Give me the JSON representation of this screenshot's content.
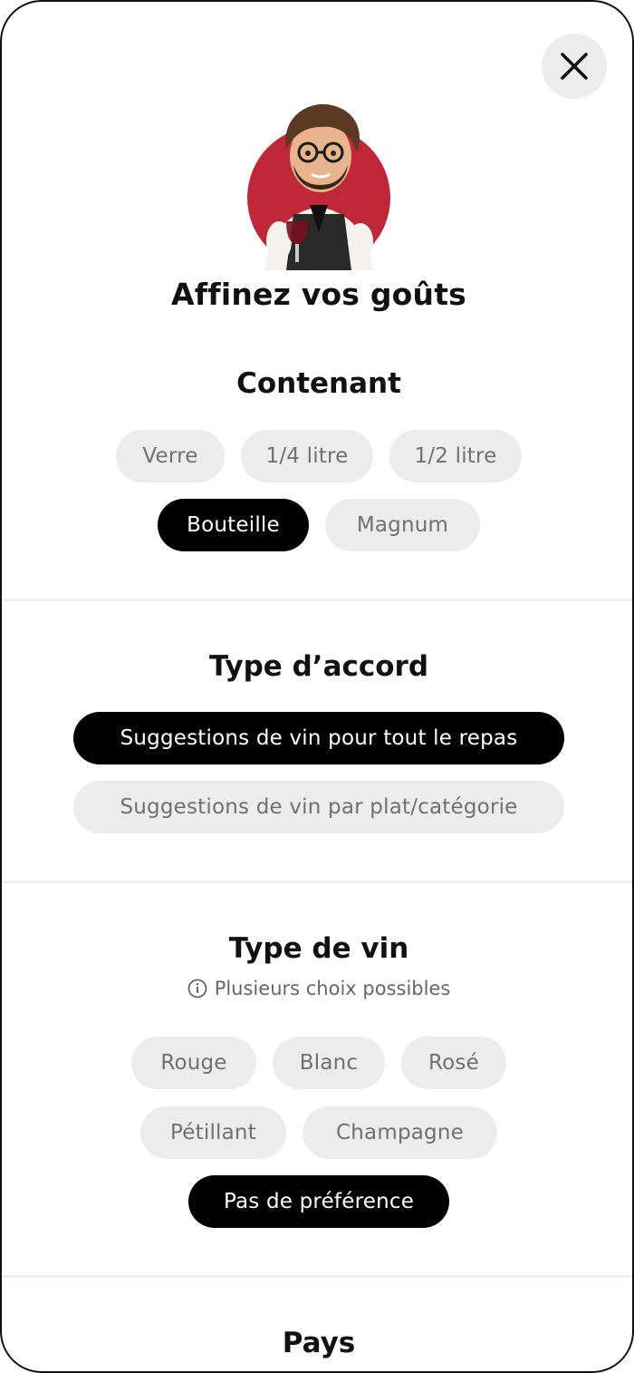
{
  "header": {
    "title": "Affinez vos goûts"
  },
  "sections": {
    "contenant": {
      "title": "Contenant",
      "options": [
        "Verre",
        "1/4 litre",
        "1/2 litre",
        "Bouteille",
        "Magnum"
      ],
      "selected": "Bouteille"
    },
    "accord": {
      "title": "Type d’accord",
      "options": [
        "Suggestions de vin pour tout le repas",
        "Suggestions de vin par plat/catégorie"
      ],
      "selected": "Suggestions de vin pour tout le repas"
    },
    "vin": {
      "title": "Type de vin",
      "hint": "Plusieurs choix possibles",
      "options": [
        "Rouge",
        "Blanc",
        "Rosé",
        "Pétillant",
        "Champagne",
        "Pas de préférence"
      ],
      "selected": "Pas de préférence"
    },
    "pays": {
      "title": "Pays"
    }
  },
  "icons": {
    "close": "close-icon",
    "info": "info-icon",
    "avatar": "sommelier-avatar"
  },
  "colors": {
    "selected_bg": "#000000",
    "chip_bg": "#ececec",
    "accent_red": "#c0283a"
  }
}
